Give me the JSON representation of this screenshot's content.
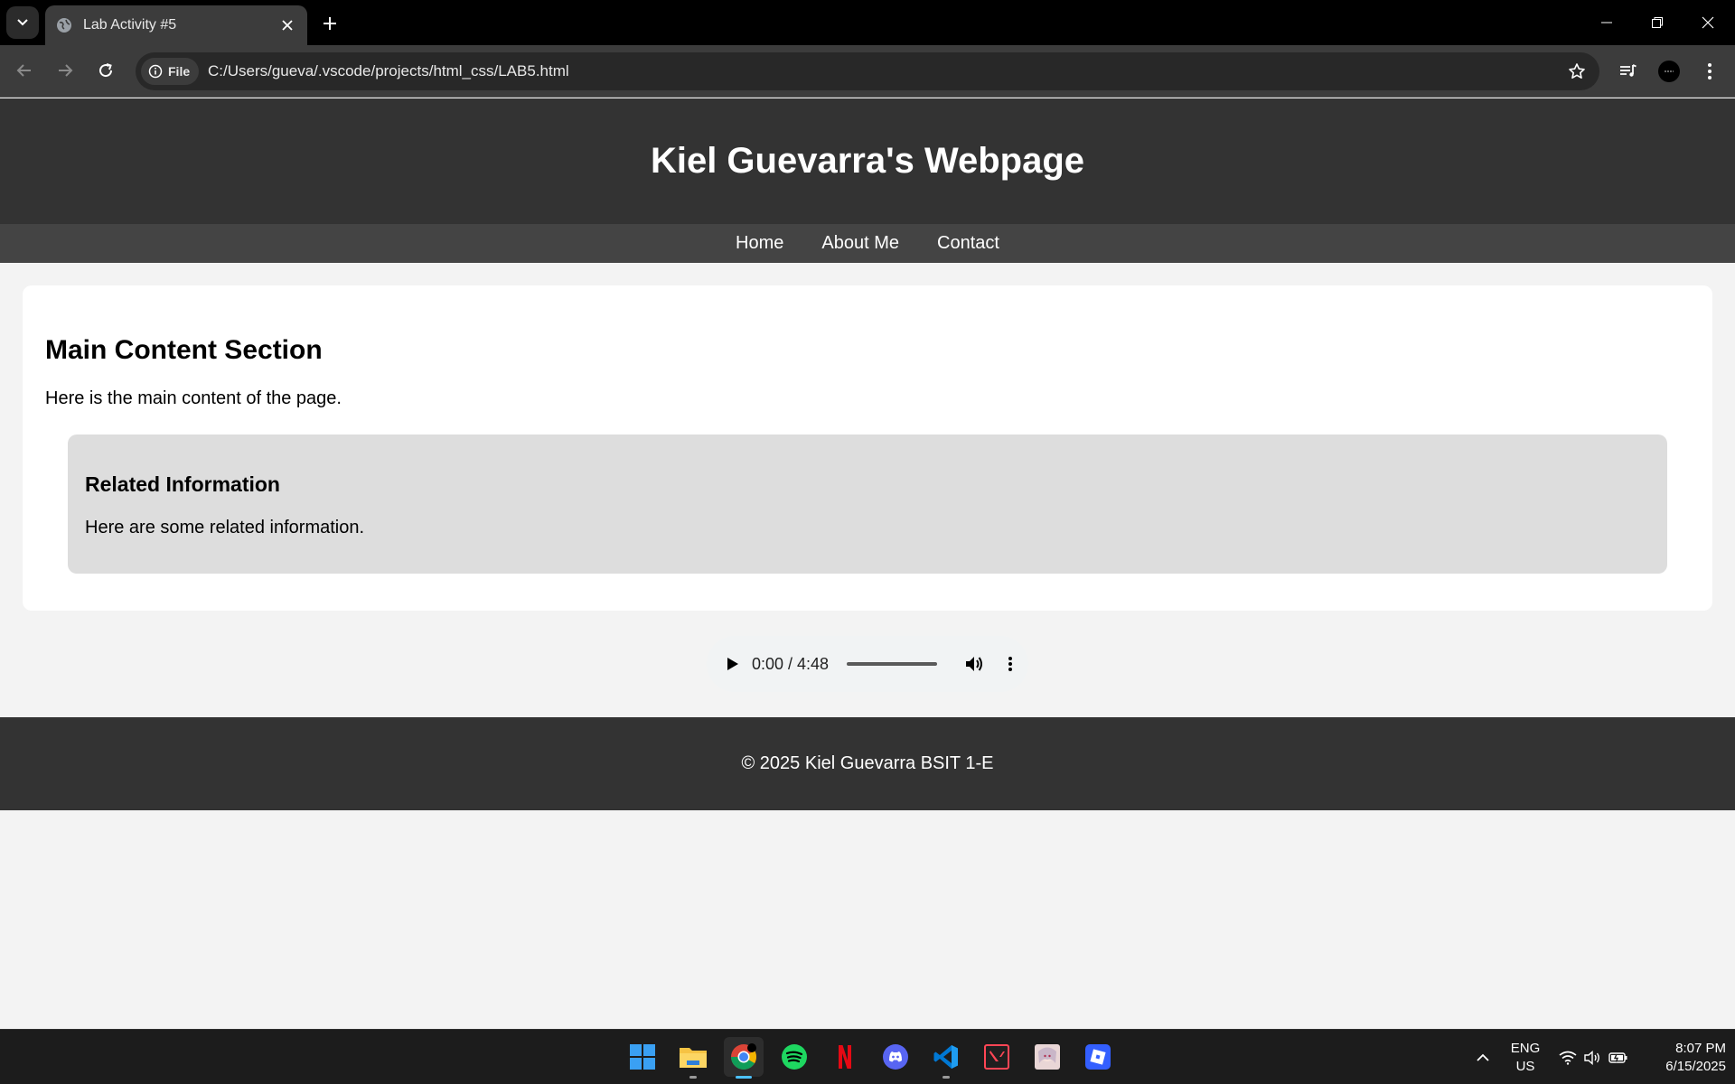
{
  "browser": {
    "tab_title": "Lab Activity #5",
    "url_chip": "File",
    "url": "C:/Users/gueva/.vscode/projects/html_css/LAB5.html"
  },
  "page": {
    "header_title": "Kiel Guevarra's Webpage",
    "nav": [
      "Home",
      "About Me",
      "Contact"
    ],
    "main_heading": "Main Content Section",
    "main_text": "Here is the main content of the page.",
    "aside_heading": "Related Information",
    "aside_text": "Here are some related information.",
    "audio_time": "0:00 / 4:48",
    "footer_text": "© 2025 Kiel Guevarra BSIT 1-E"
  },
  "taskbar": {
    "apps": [
      "start-icon",
      "file-explorer-icon",
      "chrome-icon",
      "spotify-icon",
      "netflix-icon",
      "discord-icon",
      "vscode-icon",
      "valorant-icon",
      "anime-app-icon",
      "roblox-icon"
    ],
    "lang_top": "ENG",
    "lang_bottom": "US",
    "time": "8:07 PM",
    "date": "6/15/2025"
  },
  "colors": {
    "header_bg": "#333333",
    "nav_bg": "#444444",
    "aside_bg": "#dddddd",
    "page_bg": "#f3f3f3"
  }
}
